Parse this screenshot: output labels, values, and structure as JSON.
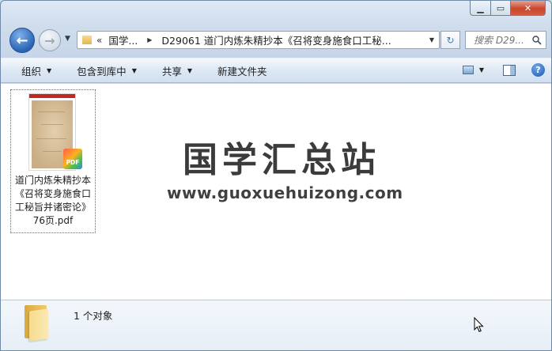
{
  "window": {
    "controls": {
      "minimize": "▁",
      "maximize": "▭",
      "close": "✕"
    }
  },
  "nav": {
    "back": "←",
    "forward": "→",
    "dropdown": "▼"
  },
  "address": {
    "chevron": "«",
    "segments": [
      "国学...",
      "D29061 道门内炼朱精抄本《召将变身施食口工秘..."
    ],
    "separator": "▶",
    "dropdown": "▼"
  },
  "refresh": "↻",
  "search": {
    "placeholder": "搜索 D29...",
    "icon": "search-icon"
  },
  "toolbar": {
    "organize": "组织",
    "include_library": "包含到库中",
    "share": "共享",
    "new_folder": "新建文件夹",
    "arrow": "▼",
    "help": "?"
  },
  "file": {
    "name_lines": [
      "道门内炼朱精抄本",
      "《召将变身施食口",
      "工秘旨并诸密论》",
      "76页.pdf"
    ],
    "badge": "PDF"
  },
  "watermark": {
    "title": "国学汇总站",
    "url": "www.guoxuehuizong.com"
  },
  "status": {
    "count": "1 个对象"
  }
}
